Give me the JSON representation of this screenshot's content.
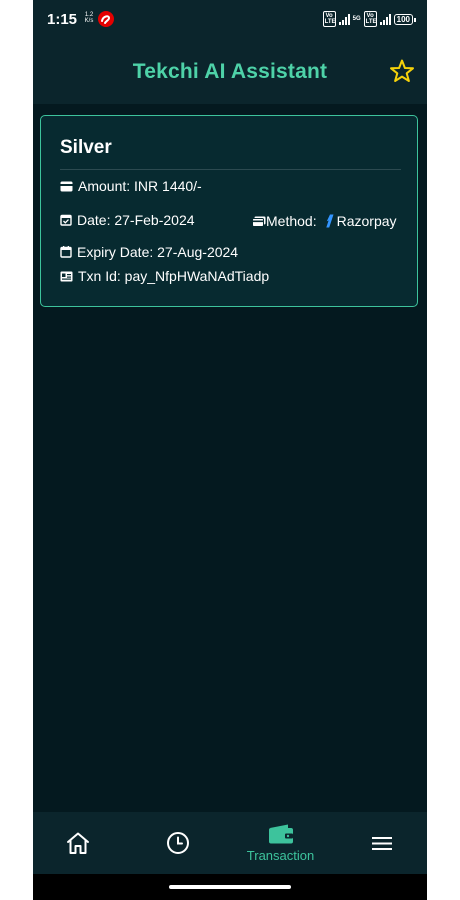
{
  "status_bar": {
    "time": "1:15",
    "net_speed_value": "1.2",
    "net_speed_unit": "K/s",
    "battery": "100",
    "volte_label": "Vo LTE",
    "network_5g": "5G"
  },
  "header": {
    "title": "Tekchi AI Assistant",
    "star_icon": "star-outline-icon",
    "accent_color": "#4ed2a8"
  },
  "transaction": {
    "plan": "Silver",
    "amount": "Amount: INR 1440/-",
    "date": "Date: 27-Feb-2024",
    "method_label": "Method:",
    "method_value": "Razorpay",
    "expiry": "Expiry Date: 27-Aug-2024",
    "txn_id": "Txn Id: pay_NfpHWaNAdTiadp"
  },
  "bottom_nav": {
    "items": [
      {
        "icon": "home-icon",
        "label": ""
      },
      {
        "icon": "clock-icon",
        "label": ""
      },
      {
        "icon": "wallet-icon",
        "label": "Transaction",
        "active": true
      },
      {
        "icon": "menu-icon",
        "label": ""
      }
    ]
  },
  "colors": {
    "background": "#04191f",
    "bar": "#0b252c",
    "card": "#072a30",
    "card_border": "#3dc39c",
    "star": "#f5d20a",
    "razorpay_blue": "#3395ff"
  }
}
